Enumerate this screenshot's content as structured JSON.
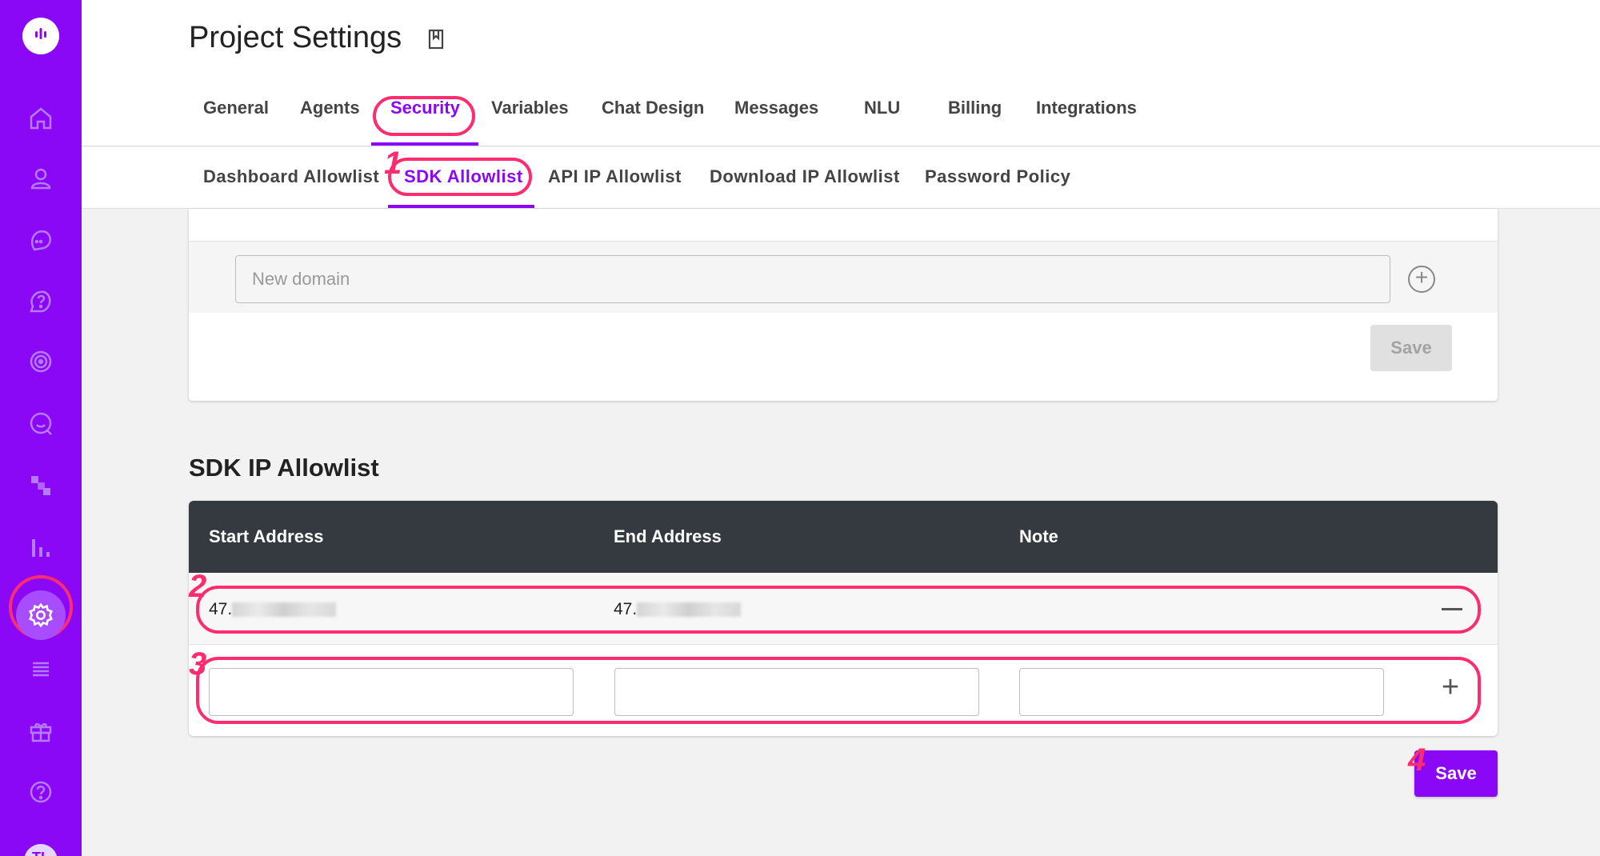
{
  "app": {
    "title": "Project Settings"
  },
  "sidebar": {
    "logo": "chat-logo-icon",
    "items": [
      {
        "icon": "home-icon"
      },
      {
        "icon": "user-icon"
      },
      {
        "icon": "chat-bubbles-icon"
      },
      {
        "icon": "help-circle-icon"
      },
      {
        "icon": "target-icon"
      },
      {
        "icon": "chat-search-icon"
      },
      {
        "icon": "flow-icon"
      },
      {
        "icon": "bar-chart-icon"
      },
      {
        "icon": "gear-icon",
        "active": true
      },
      {
        "icon": "list-icon"
      },
      {
        "icon": "gift-icon"
      },
      {
        "icon": "question-icon"
      }
    ],
    "avatar_initials": "TL"
  },
  "tabs": [
    {
      "label": "General"
    },
    {
      "label": "Agents"
    },
    {
      "label": "Security",
      "active": true
    },
    {
      "label": "Variables"
    },
    {
      "label": "Chat Design"
    },
    {
      "label": "Messages"
    },
    {
      "label": "NLU"
    },
    {
      "label": "Billing"
    },
    {
      "label": "Integrations"
    }
  ],
  "subtabs": [
    {
      "label": "Dashboard Allowlist"
    },
    {
      "label": "SDK Allowlist",
      "active": true
    },
    {
      "label": "API IP Allowlist"
    },
    {
      "label": "Download IP Allowlist"
    },
    {
      "label": "Password Policy"
    }
  ],
  "domain_section": {
    "placeholder": "New domain",
    "save_label": "Save"
  },
  "ip_section": {
    "title": "SDK IP Allowlist",
    "columns": [
      "Start Address",
      "End Address",
      "Note"
    ],
    "rows": [
      {
        "start": "47.",
        "end": "47.",
        "note": ""
      }
    ],
    "save_label": "Save"
  },
  "annotations": [
    "1",
    "2",
    "3",
    "4"
  ],
  "colors": {
    "brand": "#8b08f7",
    "annotation": "#ff2d6f",
    "table_header": "#343a40"
  }
}
